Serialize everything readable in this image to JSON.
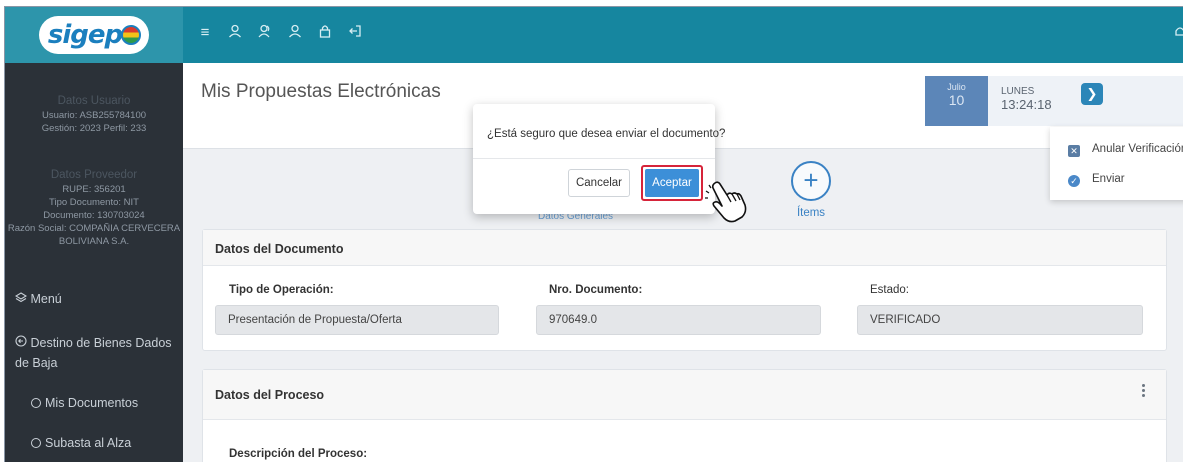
{
  "logo": {
    "text": "sigep"
  },
  "topbar": {
    "icons": [
      "menu-icon",
      "user-icon",
      "users-icon",
      "user-check-icon",
      "lock-icon",
      "logout-icon",
      "bell-icon"
    ]
  },
  "sidebar": {
    "user_head": "Datos Usuario",
    "user_line1": "Usuario: ASB255784100",
    "user_line2": "Gestión: 2023 Perfil: 233",
    "prov_head": "Datos Proveedor",
    "prov_line1": "RUPE: 356201",
    "prov_line2": "Tipo Documento: NIT",
    "prov_line3": "Documento: 130703024",
    "prov_line4": "Razón Social: COMPAÑIA CERVECERA BOLIVIANA S.A.",
    "menu": "Menú",
    "destino": "Destino de Bienes Dados de Baja",
    "mis_documentos": "Mis Documentos",
    "subasta": "Subasta al Alza"
  },
  "header": {
    "title": "Mis Propuestas Electrónicas",
    "month": "Julio",
    "day": "10",
    "weekday": "LUNES",
    "time": "13:24:18"
  },
  "dropdown": {
    "items": [
      {
        "label": "Anular Verificación",
        "icon": "x-square-icon"
      },
      {
        "label": "Enviar",
        "icon": "check-circle-icon"
      }
    ]
  },
  "tabs": {
    "partial_label": "Datos Generales",
    "items_label": "Ítems"
  },
  "card_documento": {
    "title": "Datos del Documento",
    "tipo_label": "Tipo de Operación:",
    "tipo_value": "Presentación de Propuesta/Oferta",
    "nro_label": "Nro. Documento:",
    "nro_value": "970649.0",
    "estado_label": "Estado:",
    "estado_value": "VERIFICADO"
  },
  "card_proceso": {
    "title": "Datos del Proceso",
    "desc_label": "Descripción del Proceso:"
  },
  "modal": {
    "message": "¿Está seguro que desea enviar el documento?",
    "cancel": "Cancelar",
    "accept": "Aceptar"
  }
}
